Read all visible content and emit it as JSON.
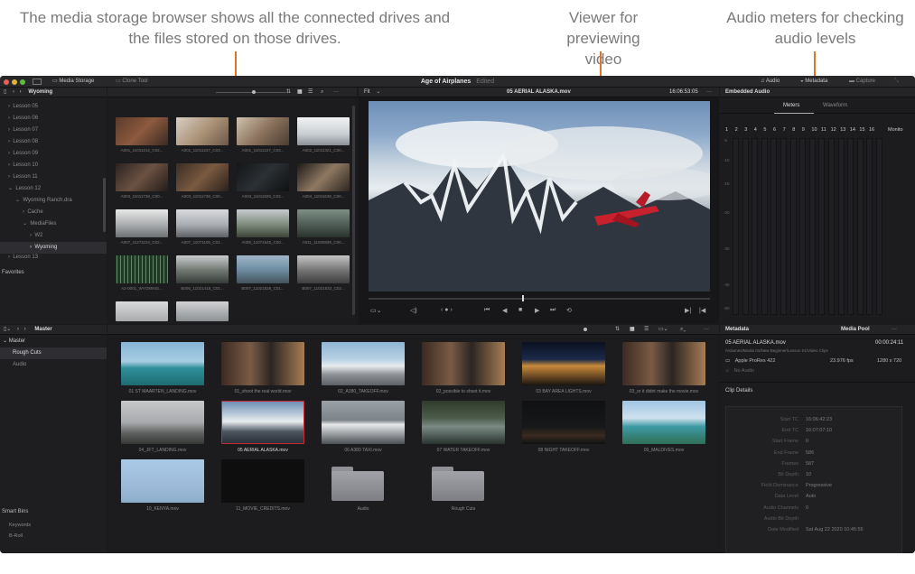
{
  "callouts": {
    "media_storage": "The media storage browser shows all the connected drives and the files stored on those drives.",
    "viewer": "Viewer for previewing video",
    "audio_meters": "Audio meters for checking audio levels"
  },
  "topbar": {
    "media_storage": "Media Storage",
    "clone_tool": "Clone Tool",
    "project": "Age of Airplanes",
    "edited": "Edited",
    "audio": "Audio",
    "metadata": "Metadata",
    "capture": "Capture"
  },
  "storage": {
    "location": "Wyoming",
    "tree": [
      "Lesson 05",
      "Lesson 06",
      "Lesson 07",
      "Lesson 08",
      "Lesson 09",
      "Lesson 10",
      "Lesson 11",
      "Lesson 12",
      "Wyoming Ranch.dra",
      "Cache",
      "MediaFiles",
      "W2",
      "Wyoming",
      "Lesson 13"
    ],
    "favorites": "Favorites",
    "thumbs": [
      "A001_11011212_C02...",
      "A001_11011227_C03...",
      "A001_11011227_C03...",
      "A002_11011321_C00...",
      "A003_11011738_C00...",
      "A003_11011738_C00...",
      "A003_11011825_C02...",
      "A004_11011639_C00...",
      "A007_11271104_C02...",
      "A007_11071105_C02...",
      "A008_11071645_C00...",
      "A011_11080839_C00...",
      "A2-0001_WYOMING...",
      "B006_11021418_C01...",
      "B007_11021828_C01...",
      "B007_11021833_C02..."
    ]
  },
  "viewer": {
    "fit": "Fit",
    "clip_name": "05 AERIAL  ALASKA.mov",
    "timecode": "16:06:53:05",
    "playhead_fraction": 0.45
  },
  "audio": {
    "title": "Embedded Audio",
    "tab_meters": "Meters",
    "tab_waveform": "Waveform",
    "channels": [
      "1",
      "2",
      "3",
      "4",
      "5",
      "6",
      "7",
      "8",
      "9",
      "10",
      "11",
      "12",
      "13",
      "14",
      "15",
      "16"
    ],
    "monitor": "Monito",
    "scale": [
      "-5",
      "-10",
      "-15",
      "-20",
      "-30",
      "-40",
      "-50"
    ]
  },
  "pool": {
    "location": "Master",
    "bins": [
      "Master",
      "Rough Cuts",
      "Audio"
    ],
    "smart_bins": "Smart Bins",
    "smart_items": [
      "Keywords",
      "B-Roll"
    ],
    "clips": [
      "01 ST MAARTEN_LANDING.mov",
      "01_shoot the real world.mov",
      "02_A380_TAKEOFF.mov",
      "02_possible to shoot it.mov",
      "03 BAY AREA LIGHTS.mov",
      "03_or it didnt make the movie.mov",
      "04_JFT_LANDING.mov",
      "05 AERIAL  ALASKA.mov",
      "06 A380 TAXI.mov",
      "07 WATER TAKEOFF.mov",
      "08 NIGHT TAKEOFF.mov",
      "09_MALDIVES.mov",
      "10_KENYA.mov",
      "11_MOVIE_CREDITS.mov",
      "Audio",
      "Rough Cuts"
    ]
  },
  "metadata": {
    "title": "Metadata",
    "pool_label": "Media Pool",
    "clip_name": "05 AERIAL  ALASKA.mov",
    "duration": "00:00:24:11",
    "path": "/Volumes/Media 01/New Beginner/Lesson 01/Video Clips",
    "codec": "Apple ProRes 422",
    "fps": "23.976 fps",
    "resolution": "1280 x 720",
    "audio": "No Audio",
    "section": "Clip Details",
    "fields": [
      {
        "k": "Start TC",
        "v": "16:06:42:23"
      },
      {
        "k": "End TC",
        "v": "16:07:07:10"
      },
      {
        "k": "Start Frame",
        "v": "0"
      },
      {
        "k": "End Frame",
        "v": "586"
      },
      {
        "k": "Frames",
        "v": "587"
      },
      {
        "k": "Bit Depth",
        "v": "10"
      },
      {
        "k": "Field Dominance",
        "v": "Progressive"
      },
      {
        "k": "Data Level",
        "v": "Auto"
      },
      {
        "k": "Audio Channels",
        "v": "0"
      },
      {
        "k": "Audio Bit Depth",
        "v": ""
      },
      {
        "k": "Date Modified",
        "v": "Sat Aug 22 2020 10:45:55"
      }
    ]
  }
}
